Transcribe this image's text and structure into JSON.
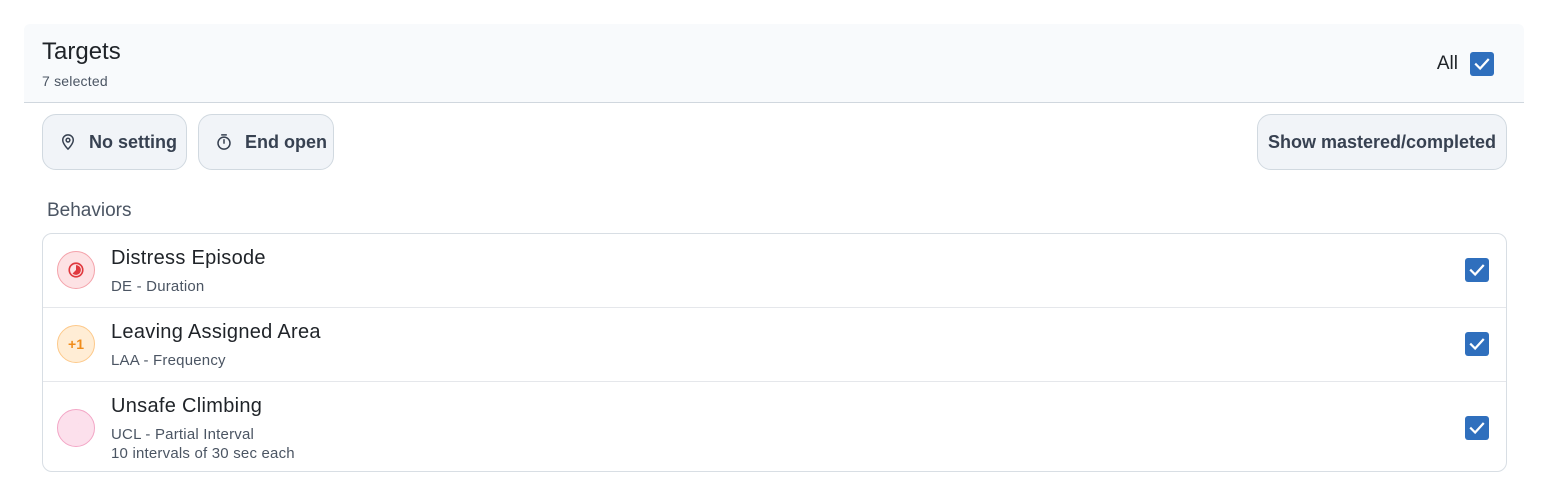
{
  "header": {
    "title": "Targets",
    "subtitle": "7 selected",
    "all_label": "All",
    "all_checked": true
  },
  "toolbar": {
    "setting_label": "No setting",
    "setting_icon": "location-pin-icon",
    "end_label": "End open",
    "end_icon": "stopwatch-icon",
    "show_label": "Show mastered/completed"
  },
  "section": {
    "label": "Behaviors"
  },
  "behaviors": [
    {
      "title": "Distress Episode",
      "subtitle": "DE - Duration",
      "icon": "duration-clock-icon",
      "checked": true
    },
    {
      "title": "Leaving Assigned Area",
      "subtitle": "LAA - Frequency",
      "badge": "+1",
      "icon": "frequency-icon",
      "checked": true
    },
    {
      "title": "Unsafe Climbing",
      "subtitle": "UCL - Partial Interval",
      "detail": "10 intervals of 30 sec each",
      "icon": "interval-moon-icon",
      "checked": true
    }
  ],
  "colors": {
    "checkbox": "#2f6fbd",
    "header_bg": "#f8fafc",
    "button_bg": "#f1f4f8",
    "duration_icon": "#e0393e",
    "frequency_icon": "#f08c1a",
    "interval_icon": "#d6336c"
  }
}
